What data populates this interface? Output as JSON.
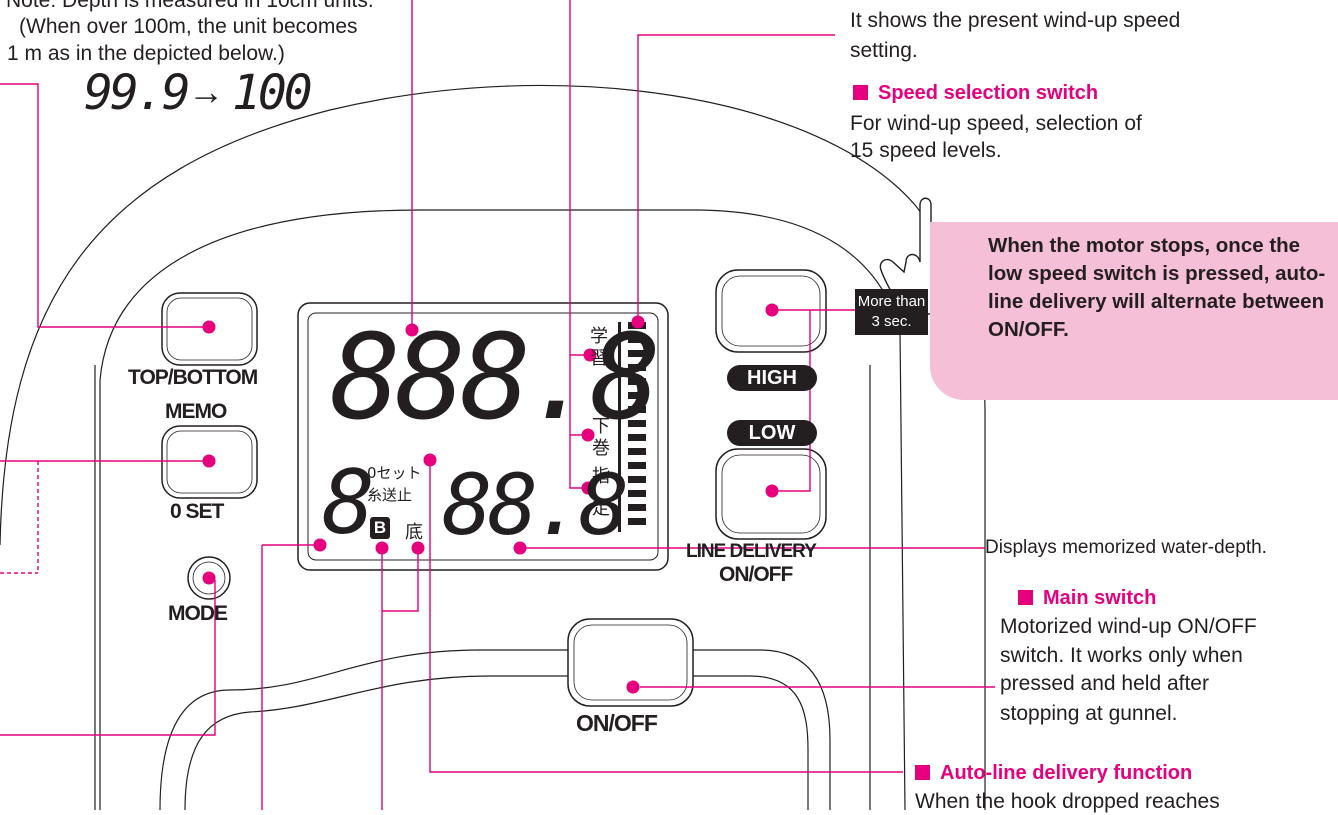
{
  "note": {
    "line1": "Note: Depth is measured in 10cm units.",
    "line2": "(When over 100m, the unit becomes",
    "line3": "1 m as in the depicted below.)",
    "example_from": "99.9",
    "example_to": "100"
  },
  "speed_display": {
    "desc_line1": "It shows the present wind-up speed",
    "desc_line2": "setting."
  },
  "speed_switch": {
    "heading": "Speed selection switch",
    "desc_line1": "For wind-up speed, selection of",
    "desc_line2": "15 speed levels."
  },
  "low_switch_callout": {
    "badge_line1": "More than",
    "badge_line2": "3 sec.",
    "text": "When the motor stops, once the low speed switch is pressed, auto-line delivery will alternate between ON/OFF."
  },
  "memo_display": {
    "desc": "Displays memorized water-depth."
  },
  "main_switch": {
    "heading": "Main switch",
    "desc_line1": "Motorized wind-up ON/OFF",
    "desc_line2": "switch. It works only when",
    "desc_line3": "pressed and held after",
    "desc_line4": "stopping at gunnel."
  },
  "auto_line": {
    "heading": "Auto-line delivery function",
    "desc_line1": "When the hook dropped reaches"
  },
  "device": {
    "btn_top_bottom": "TOP/BOTTOM",
    "btn_memo": "MEMO",
    "btn_zero_set": "0 SET",
    "btn_mode": "MODE",
    "btn_high": "HIGH",
    "btn_low": "LOW",
    "line_delivery": "LINE DELIVERY",
    "line_delivery_onoff": "ON/OFF",
    "btn_onoff": "ON/OFF"
  },
  "lcd": {
    "main_digits": "888.8",
    "sub_digit": "8",
    "memo_digits": "88.8",
    "kanji_learn_1": "学",
    "kanji_learn_2": "習",
    "kanji_down_1": "下",
    "kanji_down_2": "巻",
    "kanji_spec_1": "指",
    "kanji_spec_2": "定",
    "zero_set_label": "0セット",
    "line_stop_label": "糸送止",
    "battery_label": "B",
    "bottom_label": "底"
  },
  "colors": {
    "accent": "#e6007e",
    "callout_bg": "#f6bfd8",
    "outline": "#231f20"
  }
}
